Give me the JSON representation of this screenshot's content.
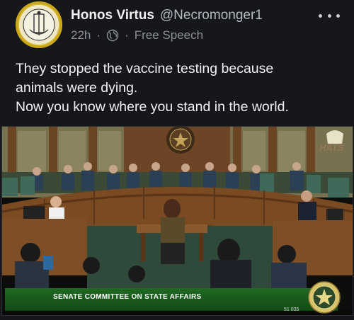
{
  "author": {
    "display_name": "Honos Virtus",
    "handle": "@Necromonger1",
    "avatar_icon": "seal-avatar-icon"
  },
  "meta": {
    "time": "22h",
    "separator": "·",
    "visibility_icon": "globe-icon",
    "channel": "Free Speech"
  },
  "post": {
    "lines": [
      "They stopped the vaccine testing because",
      "animals were dying.",
      "Now you know where you stand in the world."
    ]
  },
  "video": {
    "chyron": "SENATE COMMITTEE ON STATE AFFAIRS",
    "watermark": "HATS",
    "code": "51 035"
  },
  "colors": {
    "background": "#15171b",
    "text": "#e7e9ea",
    "muted": "#8b9098",
    "chyron_green": "#1f6a22"
  }
}
